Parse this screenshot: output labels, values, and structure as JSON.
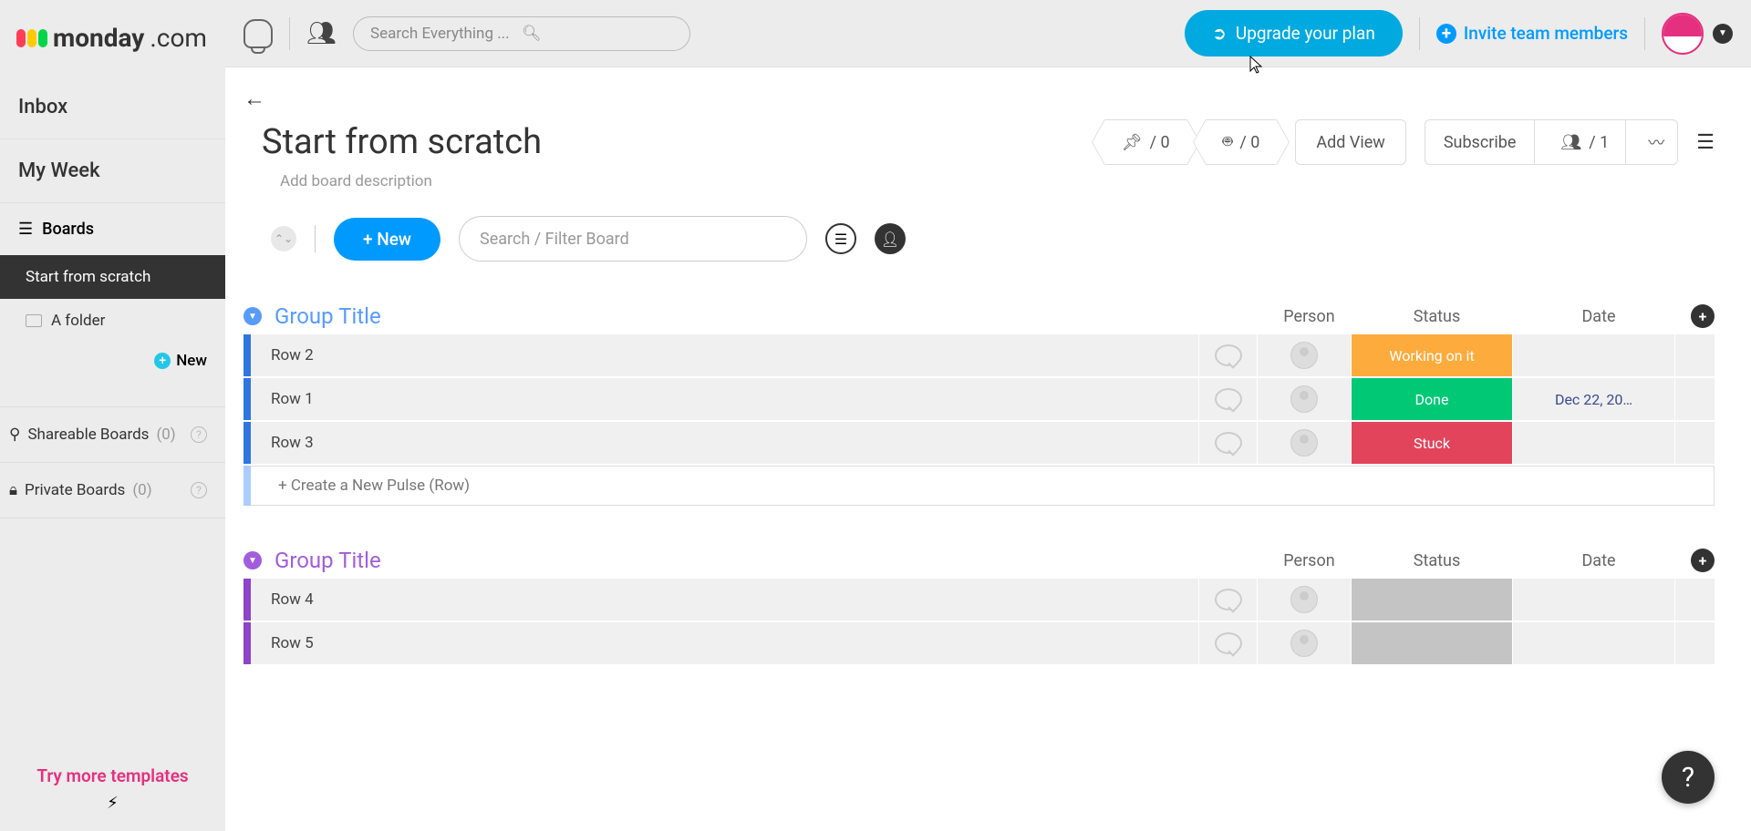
{
  "logo": "monday",
  "logo_suffix": ".com",
  "nav": {
    "inbox": "Inbox",
    "myweek": "My Week"
  },
  "boards_label": "Boards",
  "board_active": "Start from scratch",
  "folder": "A folder",
  "new_folder": "New",
  "shareable": {
    "label": "Shareable Boards",
    "count": "(0)"
  },
  "private": {
    "label": "Private Boards",
    "count": "(0)"
  },
  "templates": "Try more templates",
  "search_placeholder": "Search Everything ...",
  "upgrade": "Upgrade your plan",
  "invite": "Invite team members",
  "board": {
    "title": "Start from scratch",
    "desc": "Add board description",
    "pin_count": "/ 0",
    "robot_count": "/ 0",
    "add_view": "Add View",
    "subscribe": "Subscribe",
    "members": "/ 1"
  },
  "toolbar": {
    "new": "+ New",
    "filter_placeholder": "Search / Filter Board"
  },
  "columns": {
    "person": "Person",
    "status": "Status",
    "date": "Date"
  },
  "groups": [
    {
      "title": "Group Title",
      "color": "#579bfc",
      "accent": "#2f76e0",
      "rows": [
        {
          "name": "Row 2",
          "status_label": "Working on it",
          "status_color": "#fdab3d",
          "date": ""
        },
        {
          "name": "Row 1",
          "status_label": "Done",
          "status_color": "#00c875",
          "date": "Dec 22, 20…"
        },
        {
          "name": "Row 3",
          "status_label": "Stuck",
          "status_color": "#e2445c",
          "date": ""
        }
      ]
    },
    {
      "title": "Group Title",
      "color": "#a25ddc",
      "accent": "#8e44c9",
      "rows": [
        {
          "name": "Row 4",
          "status_label": "",
          "status_color": "#c4c4c4",
          "date": ""
        },
        {
          "name": "Row 5",
          "status_label": "",
          "status_color": "#c4c4c4",
          "date": ""
        }
      ]
    }
  ],
  "create_row": "+ Create a New Pulse (Row)"
}
